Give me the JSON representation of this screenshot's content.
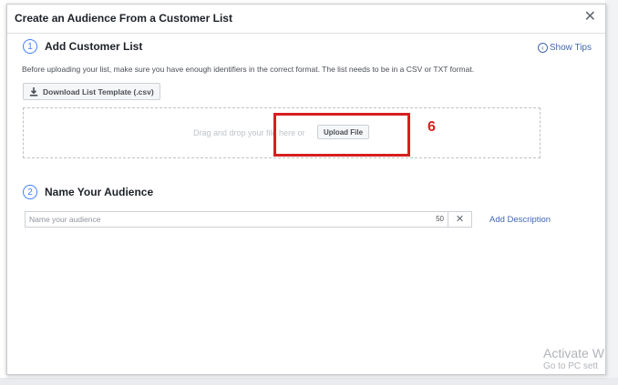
{
  "dialog": {
    "title": "Create an Audience From a Customer List",
    "close_glyph": "✕"
  },
  "step1": {
    "number": "1",
    "title": "Add Customer List",
    "show_tips": "Show Tips",
    "description": "Before uploading your list, make sure you have enough identifiers in the correct format. The list needs to be in a CSV or TXT format.",
    "download_label": "Download List Template (.csv)",
    "drop_text": "Drag and drop your file here or",
    "upload_label": "Upload File"
  },
  "annotation": {
    "number": "6",
    "color": "#d71f1f"
  },
  "step2": {
    "number": "2",
    "title": "Name Your Audience",
    "name_placeholder": "Name your audience",
    "char_count": "50",
    "clear_glyph": "✕",
    "add_description": "Add Description"
  },
  "watermark": {
    "line1": "Activate W",
    "line2": "Go to PC sett"
  },
  "colors": {
    "accent": "#4080ff",
    "link": "#4267b2"
  }
}
